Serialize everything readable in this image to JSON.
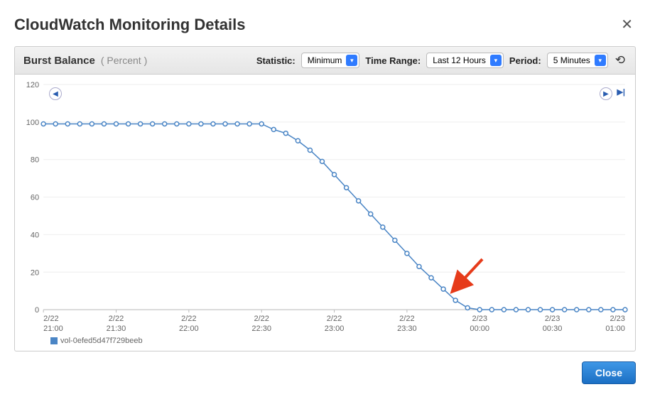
{
  "header": {
    "title": "CloudWatch Monitoring Details"
  },
  "controls": {
    "metric_name": "Burst Balance",
    "metric_unit": "( Percent )",
    "statistic_label": "Statistic:",
    "statistic_value": "Minimum",
    "timerange_label": "Time Range:",
    "timerange_value": "Last 12 Hours",
    "period_label": "Period:",
    "period_value": "5 Minutes"
  },
  "legend": {
    "series_name": "vol-0efed5d47f729beeb"
  },
  "footer": {
    "close_label": "Close"
  },
  "chart_data": {
    "type": "line",
    "title": "Burst Balance (Percent)",
    "xlabel": "",
    "ylabel": "",
    "ylim": [
      0,
      120
    ],
    "y_ticks": [
      0,
      20,
      40,
      60,
      80,
      100,
      120
    ],
    "x_categories": [
      "2/22 21:00",
      "2/22 21:30",
      "2/22 22:00",
      "2/22 22:30",
      "2/22 23:00",
      "2/22 23:30",
      "2/23 00:00",
      "2/23 00:30",
      "2/23 01:00"
    ],
    "series": [
      {
        "name": "vol-0efed5d47f729beeb",
        "color": "#4a85c5",
        "x": [
          "21:00",
          "21:05",
          "21:10",
          "21:15",
          "21:20",
          "21:25",
          "21:30",
          "21:35",
          "21:40",
          "21:45",
          "21:50",
          "21:55",
          "22:00",
          "22:05",
          "22:10",
          "22:15",
          "22:20",
          "22:25",
          "22:30",
          "22:35",
          "22:40",
          "22:45",
          "22:50",
          "22:55",
          "23:00",
          "23:05",
          "23:10",
          "23:15",
          "23:20",
          "23:25",
          "23:30",
          "23:35",
          "23:40",
          "23:45",
          "23:50",
          "23:55",
          "00:00",
          "00:05",
          "00:10",
          "00:15",
          "00:20",
          "00:25",
          "00:30",
          "00:35",
          "00:40",
          "00:45",
          "00:50",
          "00:55",
          "01:00"
        ],
        "values": [
          99,
          99,
          99,
          99,
          99,
          99,
          99,
          99,
          99,
          99,
          99,
          99,
          99,
          99,
          99,
          99,
          99,
          99,
          99,
          96,
          94,
          90,
          85,
          79,
          72,
          65,
          58,
          51,
          44,
          37,
          30,
          23,
          17,
          11,
          5,
          1,
          0,
          0,
          0,
          0,
          0,
          0,
          0,
          0,
          0,
          0,
          0,
          0,
          0
        ]
      }
    ]
  }
}
